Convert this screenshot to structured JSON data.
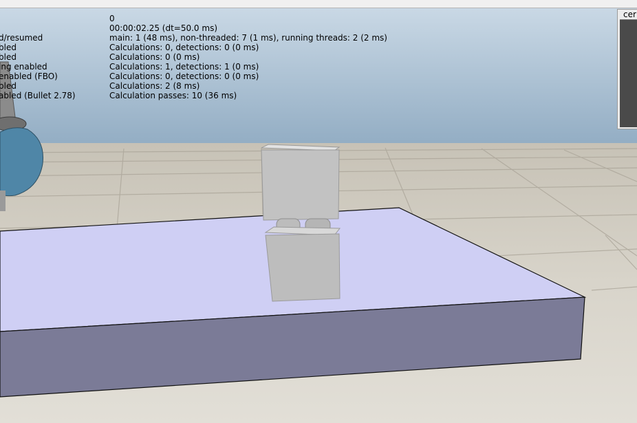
{
  "simulation": {
    "values": [
      "0",
      "00:00:02.25 (dt=50.0 ms)",
      "main: 1 (48 ms), non-threaded: 7 (1 ms), running threads: 2 (2 ms)",
      "Calculations: 0, detections: 0 (0 ms)",
      "Calculations: 0 (0 ms)",
      "Calculations: 1, detections: 1 (0 ms)",
      "Calculations: 0, detections: 0 (0 ms)",
      "Calculations: 2 (8 ms)",
      "Calculation passes: 10 (36 ms)"
    ],
    "labels": [
      "d/resumed",
      "bled",
      "bled",
      "ing enabled",
      "enabled (FBO)",
      "bled",
      "abled (Bullet 2.78)"
    ]
  },
  "vision_panel": {
    "title": "cer"
  },
  "colors": {
    "sky_top": "#c6d5e2",
    "sky_bottom": "#93aec4",
    "table_top": "#cfcff4",
    "table_front": "#7b7b97",
    "robot_blue": "#4f86a7",
    "block_gray": "#bdbdbd"
  }
}
